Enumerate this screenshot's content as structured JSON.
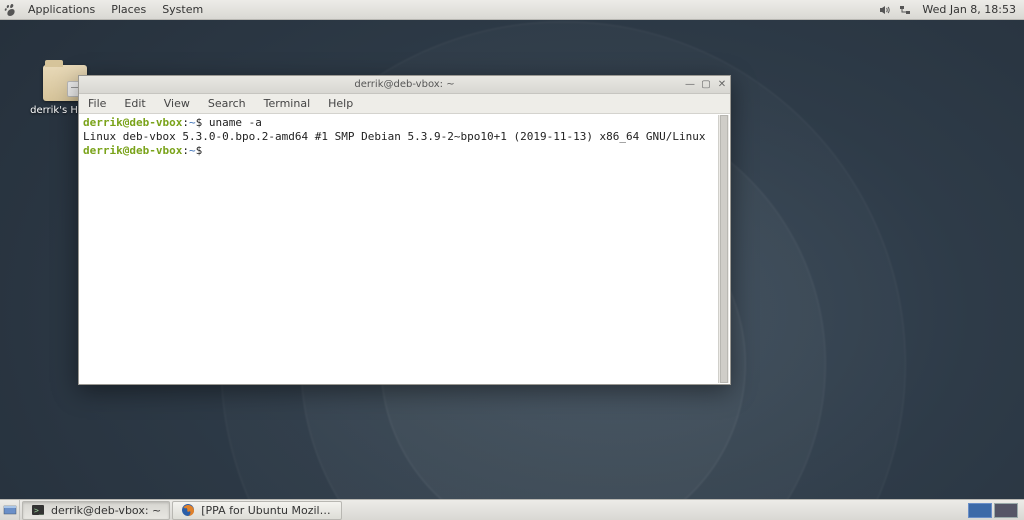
{
  "top_panel": {
    "menus": [
      "Applications",
      "Places",
      "System"
    ],
    "clock": "Wed Jan 8, 18:53"
  },
  "desktop": {
    "home_icon_label": "derrik's Home"
  },
  "terminal": {
    "title": "derrik@deb-vbox: ~",
    "menubar": [
      "File",
      "Edit",
      "View",
      "Search",
      "Terminal",
      "Help"
    ],
    "lines": [
      {
        "prompt_user": "derrik@deb-vbox",
        "prompt_sep": ":",
        "prompt_path": "~",
        "prompt_sym": "$ ",
        "cmd": "uname -a"
      },
      {
        "output": "Linux deb-vbox 5.3.0-0.bpo.2-amd64 #1 SMP Debian 5.3.9-2~bpo10+1 (2019-11-13) x86_64 GNU/Linux"
      },
      {
        "prompt_user": "derrik@deb-vbox",
        "prompt_sep": ":",
        "prompt_path": "~",
        "prompt_sym": "$ ",
        "cmd": ""
      }
    ]
  },
  "taskbar": {
    "items": [
      {
        "label": "derrik@deb-vbox: ~",
        "icon": "terminal",
        "active": true
      },
      {
        "label": "[PPA for Ubuntu Mozill…",
        "icon": "firefox",
        "active": false
      }
    ]
  }
}
